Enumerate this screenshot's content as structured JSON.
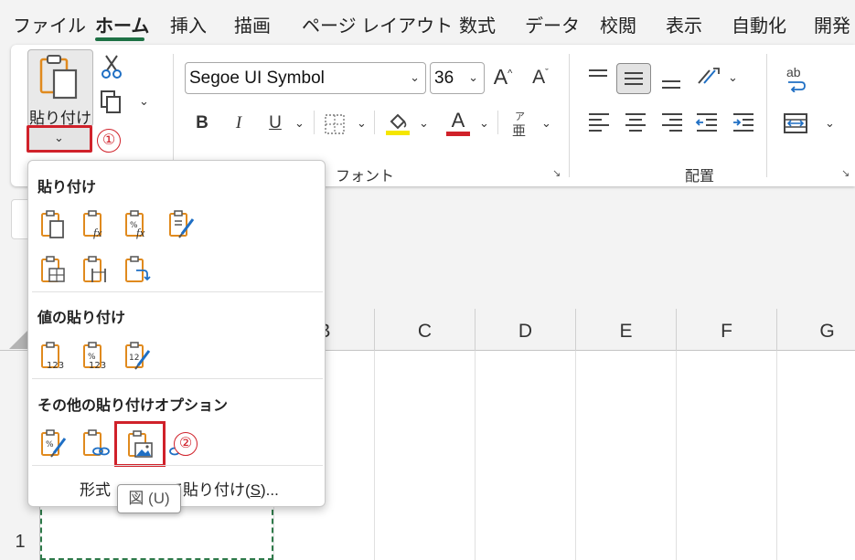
{
  "menu": {
    "tabs": [
      {
        "label": "ファイル",
        "active": false
      },
      {
        "label": "ホーム",
        "active": true
      },
      {
        "label": "挿入",
        "active": false
      },
      {
        "label": "描画",
        "active": false
      },
      {
        "label": "ページ レイアウト",
        "active": false
      },
      {
        "label": "数式",
        "active": false
      },
      {
        "label": "データ",
        "active": false
      },
      {
        "label": "校閲",
        "active": false
      },
      {
        "label": "表示",
        "active": false
      },
      {
        "label": "自動化",
        "active": false
      },
      {
        "label": "開発",
        "active": false
      }
    ],
    "accent_color": "#1e7145"
  },
  "ribbon": {
    "clipboard": {
      "paste_label": "貼り付け",
      "callout_1": "①"
    },
    "font_group": {
      "label": "フォント",
      "font_name": "Segoe UI Symbol",
      "font_size": "36",
      "bold": "B",
      "italic": "I",
      "underline": "U",
      "font_color_letter": "A",
      "grow_letter": "A",
      "shrink_letter": "A",
      "furigana_top": "ア",
      "furigana_bottom": "亜",
      "highlight_color": "#f5e600",
      "font_color": "#d0212a"
    },
    "alignment_group": {
      "label": "配置",
      "wrap_text": "ab"
    },
    "launcher_glyph": "↘"
  },
  "grid": {
    "columns": [
      "B",
      "C",
      "D",
      "E",
      "F",
      "G"
    ],
    "rows": [
      "1"
    ]
  },
  "paste_menu": {
    "section_paste": "貼り付け",
    "section_values": "値の貼り付け",
    "section_other": "その他の貼り付けオプション",
    "footer_prefix": "形式",
    "footer_suffix": "て貼り付け(",
    "footer_key": "S",
    "footer_end": ")...",
    "callout_2": "②",
    "tooltip": "図 (U)"
  }
}
